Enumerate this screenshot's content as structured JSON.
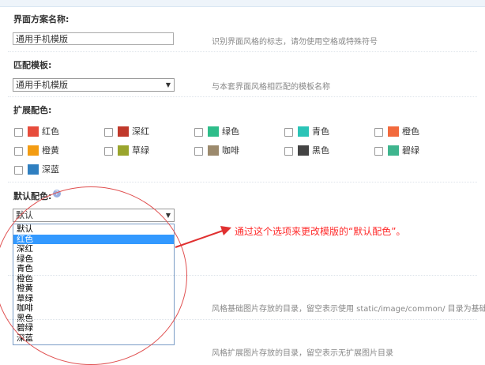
{
  "scheme_name": {
    "label": "界面方案名称:",
    "value": "通用手机模版",
    "hint": "识别界面风格的标志，请勿使用空格或特殊符号"
  },
  "template": {
    "label": "匹配模板:",
    "value": "通用手机模版",
    "hint": "与本套界面风格相匹配的模板名称"
  },
  "colors": {
    "label": "扩展配色:",
    "items": [
      {
        "name": "红色",
        "color": "#e74c3c"
      },
      {
        "name": "深红",
        "color": "#c0392b"
      },
      {
        "name": "绿色",
        "color": "#2ebd8a"
      },
      {
        "name": "青色",
        "color": "#2bc4b7"
      },
      {
        "name": "橙色",
        "color": "#f26a3d"
      },
      {
        "name": "橙黄",
        "color": "#f39c12"
      },
      {
        "name": "草绿",
        "color": "#9aa52d"
      },
      {
        "name": "咖啡",
        "color": "#9c8a6d"
      },
      {
        "name": "黑色",
        "color": "#444444"
      },
      {
        "name": "碧绿",
        "color": "#3fb58e"
      },
      {
        "name": "深蓝",
        "color": "#2f7fc0"
      }
    ]
  },
  "default_color": {
    "label": "默认配色:",
    "value": "默认",
    "options": [
      "默认",
      "红色",
      "深红",
      "绿色",
      "青色",
      "橙色",
      "橙黄",
      "草绿",
      "咖啡",
      "黑色",
      "碧绿",
      "深蓝"
    ],
    "selected_index": 1
  },
  "hints": {
    "base_image_dir": "风格基础图片存放的目录，留空表示使用  static/image/common/  目录为基础图",
    "ext_image_dir": "风格扩展图片存放的目录，留空表示无扩展图片目录"
  },
  "annotation": {
    "text": "通过这个选项来更改模版的“默认配色”。",
    "color": "#ff2a2a"
  }
}
